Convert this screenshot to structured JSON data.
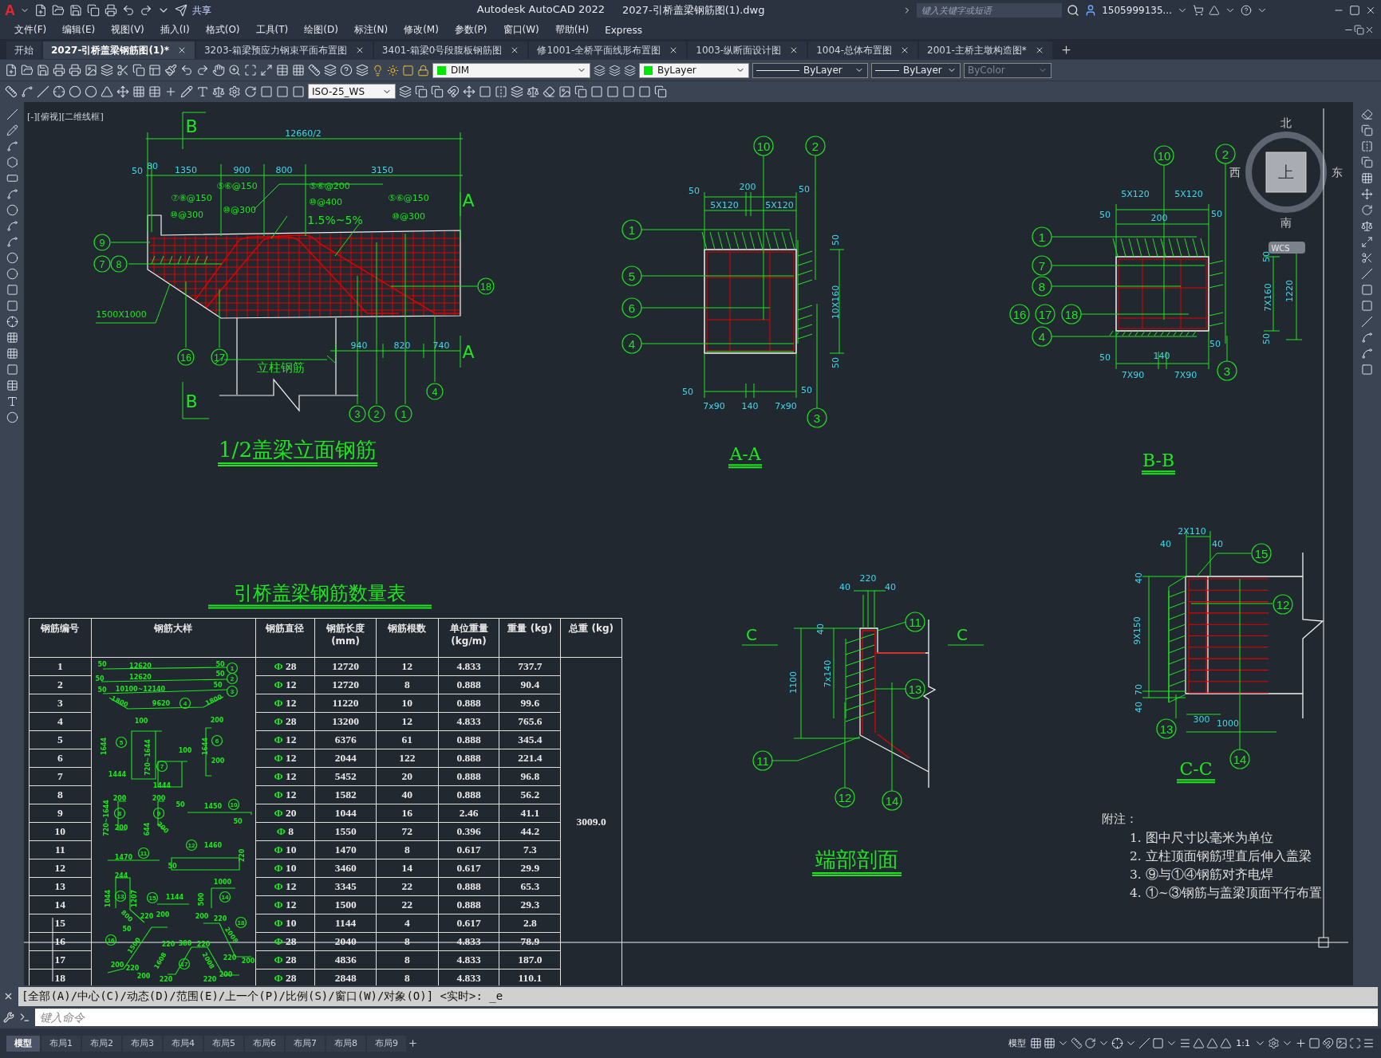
{
  "title_bar": {
    "logo": "A",
    "share": "共享",
    "app": "Autodesk AutoCAD 2022",
    "file": "2027-引桥盖梁钢筋图(1).dwg",
    "search": {
      "placeholder": "键入关键字或短语"
    },
    "user": "1505999135..."
  },
  "menu": [
    "文件(F)",
    "编辑(E)",
    "视图(V)",
    "插入(I)",
    "格式(O)",
    "工具(T)",
    "绘图(D)",
    "标注(N)",
    "修改(M)",
    "参数(P)",
    "窗口(W)",
    "帮助(H)",
    "Express"
  ],
  "doc_tabs": [
    {
      "label": "开始",
      "selected": false,
      "closable": false
    },
    {
      "label": "2027-引桥盖梁钢筋图(1)*",
      "selected": true,
      "closable": true
    },
    {
      "label": "3203-箱梁预应力钢束平面布置图",
      "selected": false,
      "closable": true
    },
    {
      "label": "3401-箱梁0号段腹板钢筋图",
      "selected": false,
      "closable": true
    },
    {
      "label": "修1001-全桥平面线形布置图",
      "selected": false,
      "closable": true
    },
    {
      "label": "1003-纵断面设计图",
      "selected": false,
      "closable": true
    },
    {
      "label": "1004-总体布置图",
      "selected": false,
      "closable": true
    },
    {
      "label": "2001-主桥主墩构造图*",
      "selected": false,
      "closable": true
    }
  ],
  "properties": {
    "layer": "DIM",
    "color_setting": "ByLayer",
    "linetype": "ByLayer",
    "lineweight": "ByLayer",
    "plot_style": {
      "label": "ByColor",
      "disabled": true
    }
  },
  "dim_style": "ISO-25_WS",
  "viewport_label": "[-][俯视][二维线框]",
  "viewcube": {
    "north": "北",
    "south": "南",
    "west": "西",
    "east": "东",
    "face": "上",
    "ucs": "WCS"
  },
  "elevation": {
    "title": "1/2盖梁立面钢筋",
    "labels": [
      "B",
      "B",
      "12660/2",
      "50",
      "80",
      "1350",
      "900",
      "800",
      "3150",
      "⑤⑥@150",
      "⑦⑧@150",
      "⑩@300",
      "⑩@300",
      "⑤⑥@200",
      "⑩@400",
      "1.5%~5%",
      "⑤⑥@150",
      "⑩@300",
      "A",
      "A",
      "1500X1000",
      "立柱钢筋",
      "940",
      "820",
      "740"
    ],
    "callouts": [
      "9",
      "7",
      "8",
      "16",
      "17",
      "3",
      "2",
      "1",
      "4",
      "18"
    ]
  },
  "section_aa": {
    "title": "A-A",
    "labels": [
      "50",
      "200",
      "50",
      "5X120",
      "5X120",
      "50",
      "10X160",
      "50",
      "50",
      "50",
      "7x90",
      "140",
      "7x90"
    ],
    "callouts": [
      "10",
      "2",
      "1",
      "5",
      "6",
      "4",
      "3"
    ]
  },
  "section_bb": {
    "title": "B-B",
    "labels": [
      "5X120",
      "5X120",
      "50",
      "200",
      "50",
      "50",
      "7X160",
      "1220",
      "50",
      "50",
      "50",
      "140",
      "7X90",
      "7X90"
    ],
    "callouts": [
      "10",
      "2",
      "1",
      "7",
      "8",
      "16",
      "17",
      "18",
      "4",
      "3"
    ]
  },
  "end_section": {
    "title": "端部剖面",
    "labels": [
      "C",
      "C",
      "220",
      "40",
      "40",
      "40",
      "1100",
      "7x140"
    ],
    "callouts": [
      "11",
      "13",
      "11",
      "12",
      "14"
    ]
  },
  "section_cc": {
    "title": "C-C",
    "labels": [
      "2X110",
      "40",
      "40",
      "40",
      "9X150",
      "70",
      "40",
      "300",
      "1000"
    ],
    "callouts": [
      "15",
      "12",
      "13",
      "14"
    ]
  },
  "table": {
    "title": "引桥盖梁钢筋数量表",
    "columns": [
      "钢筋编号",
      "钢筋大样",
      "钢筋直径",
      "钢筋长度 (mm)",
      "钢筋根数",
      "单位重量 (kg/m)",
      "重量 (kg)",
      "总重 (kg)"
    ],
    "total": "3009.0",
    "rows": [
      {
        "no": "1",
        "symbol": "Φ",
        "diameter": "28",
        "length": "12720",
        "count": "12",
        "unit_weight": "4.833",
        "weight": "737.7"
      },
      {
        "no": "2",
        "symbol": "Φ",
        "diameter": "12",
        "length": "12720",
        "count": "8",
        "unit_weight": "0.888",
        "weight": "90.4"
      },
      {
        "no": "3",
        "symbol": "Φ",
        "diameter": "12",
        "length": "11220",
        "count": "10",
        "unit_weight": "0.888",
        "weight": "99.6"
      },
      {
        "no": "4",
        "symbol": "Φ",
        "diameter": "28",
        "length": "13200",
        "count": "12",
        "unit_weight": "4.833",
        "weight": "765.6"
      },
      {
        "no": "5",
        "symbol": "Φ",
        "diameter": "12",
        "length": "6376",
        "count": "61",
        "unit_weight": "0.888",
        "weight": "345.4"
      },
      {
        "no": "6",
        "symbol": "Φ",
        "diameter": "12",
        "length": "2044",
        "count": "122",
        "unit_weight": "0.888",
        "weight": "221.4"
      },
      {
        "no": "7",
        "symbol": "Φ",
        "diameter": "12",
        "length": "5452",
        "count": "20",
        "unit_weight": "0.888",
        "weight": "96.8"
      },
      {
        "no": "8",
        "symbol": "Φ",
        "diameter": "12",
        "length": "1582",
        "count": "40",
        "unit_weight": "0.888",
        "weight": "56.2"
      },
      {
        "no": "9",
        "symbol": "Φ",
        "diameter": "20",
        "length": "1044",
        "count": "16",
        "unit_weight": "2.46",
        "weight": "41.1"
      },
      {
        "no": "10",
        "symbol": "Φ",
        "diameter": "8",
        "length": "1550",
        "count": "72",
        "unit_weight": "0.396",
        "weight": "44.2"
      },
      {
        "no": "11",
        "symbol": "Φ",
        "diameter": "10",
        "length": "1470",
        "count": "8",
        "unit_weight": "0.617",
        "weight": "7.3"
      },
      {
        "no": "12",
        "symbol": "Φ",
        "diameter": "10",
        "length": "3460",
        "count": "14",
        "unit_weight": "0.617",
        "weight": "29.9"
      },
      {
        "no": "13",
        "symbol": "Φ",
        "diameter": "12",
        "length": "3345",
        "count": "22",
        "unit_weight": "0.888",
        "weight": "65.3"
      },
      {
        "no": "14",
        "symbol": "Φ",
        "diameter": "12",
        "length": "1500",
        "count": "22",
        "unit_weight": "0.888",
        "weight": "29.3"
      },
      {
        "no": "15",
        "symbol": "Φ",
        "diameter": "10",
        "length": "1144",
        "count": "4",
        "unit_weight": "0.617",
        "weight": "2.8"
      },
      {
        "no": "16",
        "symbol": "Φ",
        "diameter": "28",
        "length": "2040",
        "count": "8",
        "unit_weight": "4.833",
        "weight": "78.9"
      },
      {
        "no": "17",
        "symbol": "Φ",
        "diameter": "28",
        "length": "4836",
        "count": "8",
        "unit_weight": "4.833",
        "weight": "187.0"
      },
      {
        "no": "18",
        "symbol": "Φ",
        "diameter": "28",
        "length": "2848",
        "count": "8",
        "unit_weight": "4.833",
        "weight": "110.1"
      }
    ],
    "bar_sketch": [
      {
        "text": "50",
        "kind": "dim"
      },
      {
        "text": "12620",
        "kind": "dim"
      },
      {
        "text": "50",
        "kind": "dim"
      },
      {
        "text": "1",
        "kind": "callout"
      },
      {
        "text": "50",
        "kind": "dim"
      },
      {
        "text": "12620",
        "kind": "dim"
      },
      {
        "text": "50",
        "kind": "dim"
      },
      {
        "text": "2",
        "kind": "callout"
      },
      {
        "text": "50",
        "kind": "dim"
      },
      {
        "text": "10100~12140",
        "kind": "dim"
      },
      {
        "text": "50",
        "kind": "dim"
      },
      {
        "text": "3",
        "kind": "callout"
      },
      {
        "text": "1800",
        "kind": "dim"
      },
      {
        "text": "9620",
        "kind": "dim"
      },
      {
        "text": "4",
        "kind": "callout"
      },
      {
        "text": "1800",
        "kind": "dim"
      },
      {
        "text": "100",
        "kind": "dim"
      },
      {
        "text": "5",
        "kind": "callout"
      },
      {
        "text": "1644",
        "kind": "dim"
      },
      {
        "text": "1444",
        "kind": "dim"
      },
      {
        "text": "720~1644",
        "kind": "dim"
      },
      {
        "text": "7",
        "kind": "callout"
      },
      {
        "text": "100",
        "kind": "dim"
      },
      {
        "text": "1444",
        "kind": "dim"
      },
      {
        "text": "200",
        "kind": "dim"
      },
      {
        "text": "6",
        "kind": "callout"
      },
      {
        "text": "1644",
        "kind": "dim"
      },
      {
        "text": "200",
        "kind": "dim"
      },
      {
        "text": "200",
        "kind": "dim"
      },
      {
        "text": "8",
        "kind": "callout"
      },
      {
        "text": "720~1644",
        "kind": "dim"
      },
      {
        "text": "200",
        "kind": "dim"
      },
      {
        "text": "200",
        "kind": "dim"
      },
      {
        "text": "9",
        "kind": "callout"
      },
      {
        "text": "644",
        "kind": "dim"
      },
      {
        "text": "200",
        "kind": "dim"
      },
      {
        "text": "50",
        "kind": "dim"
      },
      {
        "text": "1450",
        "kind": "dim"
      },
      {
        "text": "10",
        "kind": "callout"
      },
      {
        "text": "50",
        "kind": "dim"
      },
      {
        "text": "1470",
        "kind": "dim"
      },
      {
        "text": "11",
        "kind": "callout"
      },
      {
        "text": "12",
        "kind": "callout"
      },
      {
        "text": "1460",
        "kind": "dim"
      },
      {
        "text": "220",
        "kind": "dim"
      },
      {
        "text": "50",
        "kind": "dim"
      },
      {
        "text": "244",
        "kind": "dim"
      },
      {
        "text": "13",
        "kind": "callout"
      },
      {
        "text": "1044",
        "kind": "dim"
      },
      {
        "text": "1207",
        "kind": "dim"
      },
      {
        "text": "800",
        "kind": "dim"
      },
      {
        "text": "50",
        "kind": "dim"
      },
      {
        "text": "15",
        "kind": "callout"
      },
      {
        "text": "1144",
        "kind": "dim"
      },
      {
        "text": "1000",
        "kind": "dim"
      },
      {
        "text": "500",
        "kind": "dim"
      },
      {
        "text": "14",
        "kind": "callout"
      },
      {
        "text": "16",
        "kind": "callout"
      },
      {
        "text": "220",
        "kind": "dim"
      },
      {
        "text": "200",
        "kind": "dim"
      },
      {
        "text": "1500",
        "kind": "dim"
      },
      {
        "text": "200",
        "kind": "dim"
      },
      {
        "text": "220",
        "kind": "dim"
      },
      {
        "text": "200",
        "kind": "dim"
      },
      {
        "text": "220",
        "kind": "dim"
      },
      {
        "text": "380",
        "kind": "dim"
      },
      {
        "text": "220",
        "kind": "dim"
      },
      {
        "text": "1608",
        "kind": "dim"
      },
      {
        "text": "17",
        "kind": "callout"
      },
      {
        "text": "2008",
        "kind": "dim"
      },
      {
        "text": "220",
        "kind": "dim"
      },
      {
        "text": "220",
        "kind": "dim"
      },
      {
        "text": "200",
        "kind": "dim"
      },
      {
        "text": "200",
        "kind": "dim"
      },
      {
        "text": "220",
        "kind": "dim"
      },
      {
        "text": "18",
        "kind": "callout"
      },
      {
        "text": "2008",
        "kind": "dim"
      },
      {
        "text": "220",
        "kind": "dim"
      },
      {
        "text": "200",
        "kind": "dim"
      }
    ]
  },
  "notes": {
    "heading": "附注：",
    "items": [
      "1. 图中尺寸以毫米为单位",
      "2. 立柱顶面钢筋理直后伸入盖梁",
      "3. ⑨与①④钢筋对齐电焊",
      "4. ①~③钢筋与盖梁顶面平行布置"
    ]
  },
  "command": {
    "history": "[全部(A)/中心(C)/动态(D)/范围(E)/上一个(P)/比例(S)/窗口(W)/对象(O)] <实时>: _e",
    "placeholder": "键入命令"
  },
  "layout_tabs": [
    {
      "label": "模型",
      "selected": true
    },
    {
      "label": "布局1",
      "selected": false
    },
    {
      "label": "布局2",
      "selected": false
    },
    {
      "label": "布局3",
      "selected": false
    },
    {
      "label": "布局4",
      "selected": false
    },
    {
      "label": "布局5",
      "selected": false
    },
    {
      "label": "布局6",
      "selected": false
    },
    {
      "label": "布局7",
      "selected": false
    },
    {
      "label": "布局8",
      "selected": false
    },
    {
      "label": "布局9",
      "selected": false
    }
  ],
  "status": {
    "model": "模型",
    "scale": "1:1"
  }
}
